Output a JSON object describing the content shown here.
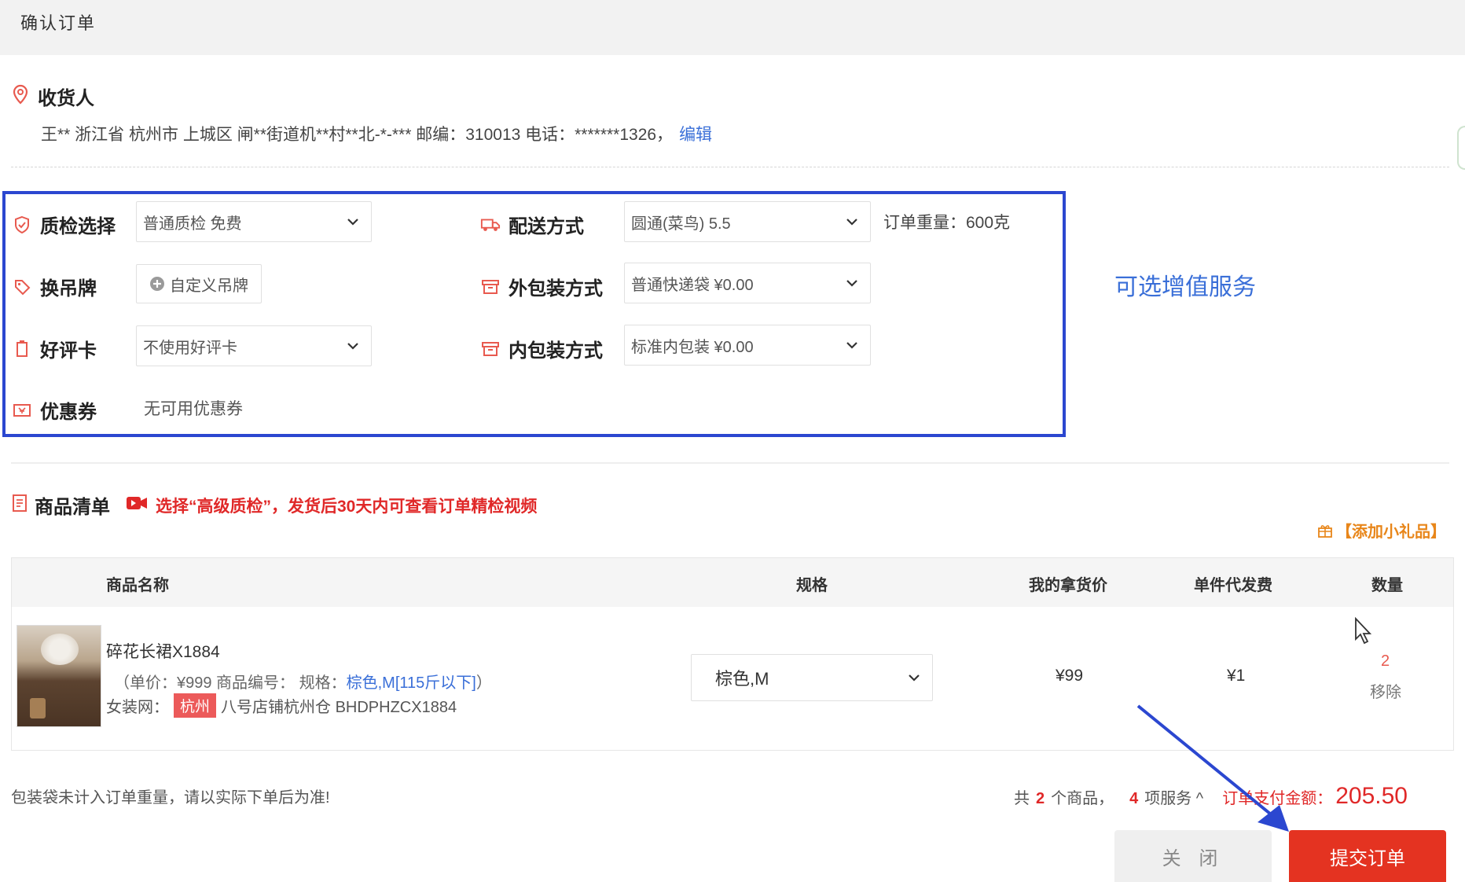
{
  "window": {
    "title": "确认订单"
  },
  "consignee": {
    "label": "收货人",
    "address": "王** 浙江省 杭州市 上城区 闸**街道机**村**北-*-*** 邮编：310013 电话：*******1326，",
    "edit": "编辑"
  },
  "services": {
    "quality": {
      "label": "质检选择",
      "value": "普通质检    免费"
    },
    "shipping": {
      "label": "配送方式",
      "value": "圆通(菜鸟) 5.5"
    },
    "weight": "订单重量：600克",
    "tag": {
      "label": "换吊牌",
      "button": "自定义吊牌"
    },
    "outer_pack": {
      "label": "外包装方式",
      "value": "普通快递袋 ¥0.00"
    },
    "review_card": {
      "label": "好评卡",
      "value": "不使用好评卡"
    },
    "inner_pack": {
      "label": "内包装方式",
      "value": "标准内包装 ¥0.00"
    },
    "coupon": {
      "label": "优惠券",
      "value": "无可用优惠券"
    },
    "annotation": "可选增值服务"
  },
  "goods": {
    "label": "商品清单",
    "notice": "选择“高级质检”，发货后30天内可查看订单精检视频",
    "add_gift": "【添加小礼品】",
    "columns": [
      "商品名称",
      "规格",
      "我的拿货价",
      "单件代发费",
      "数量"
    ],
    "items": [
      {
        "name": "碎花长裙X1884",
        "meta_prefix": "（单价：¥999   商品编号：    规格：",
        "meta_spec": "棕色,M[115斤以下]",
        "meta_suffix": "）",
        "shop_prefix": "女装网：",
        "city": "杭州",
        "shop": "八号店铺杭州仓 BHDPHZCX1884",
        "spec": "棕色,M",
        "price": "¥99",
        "fee": "¥1",
        "qty": "2",
        "remove": "移除"
      }
    ]
  },
  "footer": {
    "note": "包装袋未计入订单重量，请以实际下单后为准!",
    "total_prefix": "共",
    "goods_count": "2",
    "goods_unit": "个商品，",
    "service_count": "4",
    "service_unit": "项服务 ^",
    "pay_label": "订单支付金额：",
    "amount": "205.50"
  },
  "buttons": {
    "close": "关 闭",
    "submit": "提交订单"
  },
  "colors": {
    "accent_blue": "#2b47d0",
    "brand_red": "#e43321",
    "link_blue": "#3a6fd8"
  }
}
